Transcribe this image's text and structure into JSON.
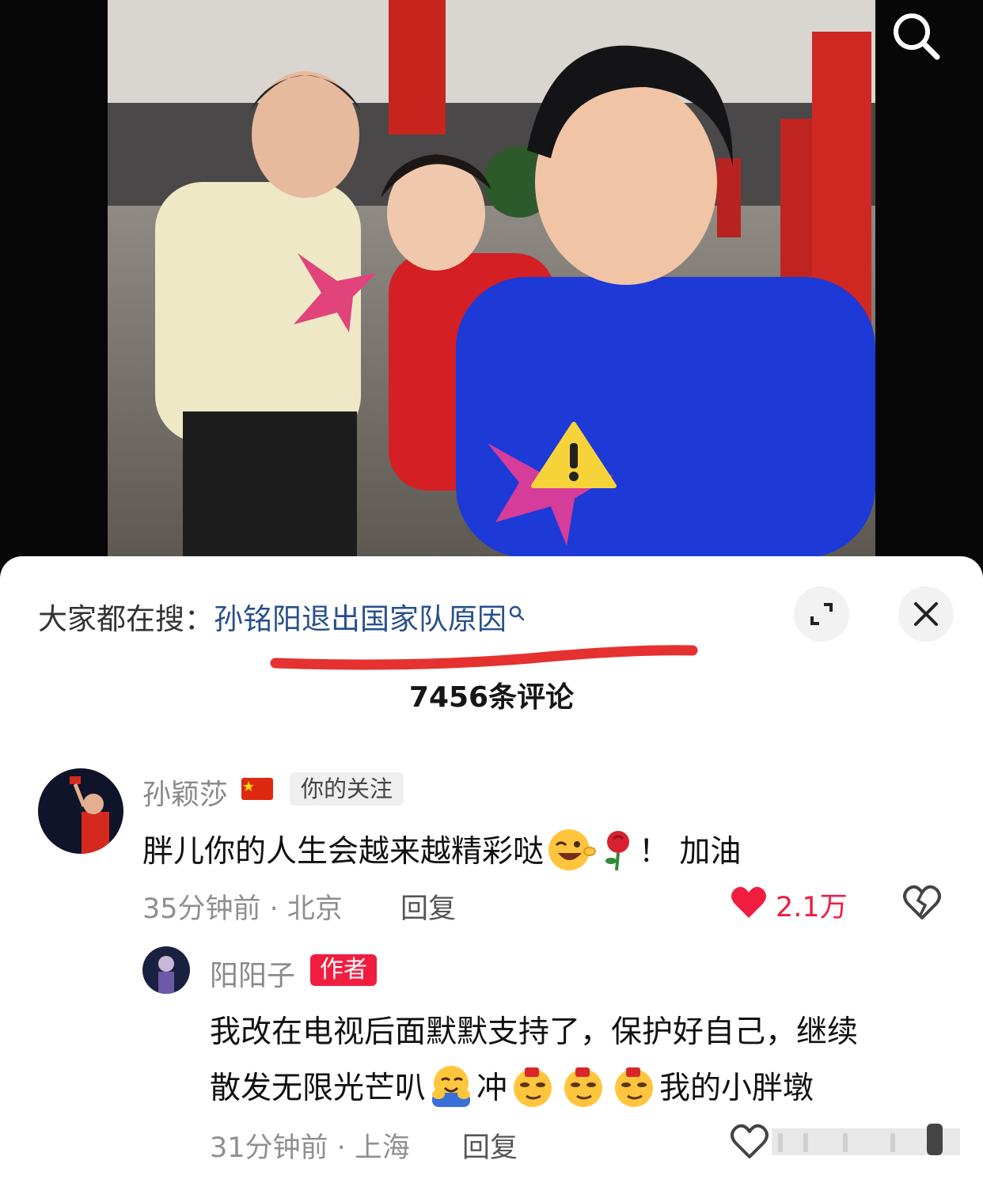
{
  "hot_search": {
    "prefix": "大家都在搜：",
    "query": "孙铭阳退出国家队原因"
  },
  "comment_count": "7456条评论",
  "comments": [
    {
      "user": "孙颖莎",
      "badge": "你的关注",
      "text_main": "胖儿你的人生会越来越精彩哒",
      "text_tail": "！ 加油",
      "time_loc": "35分钟前 · 北京",
      "reply_label": "回复",
      "likes": "2.1万"
    },
    {
      "user": "阳阳子",
      "badge": "作者",
      "line1": "我改在电视后面默默支持了，保护好自己，继续",
      "line2_a": "散发无限光芒叭",
      "line2_b": "冲",
      "line2_c": "我的小胖墩",
      "time_loc": "31分钟前 · 上海",
      "reply_label": "回复"
    }
  ],
  "colors": {
    "accent_red": "#f01d41",
    "link_blue": "#28508c"
  },
  "icons": [
    "search-icon",
    "expand-icon",
    "close-icon",
    "heart-filled-icon",
    "dislike-heart-icon",
    "heart-outline-icon",
    "warning-icon"
  ]
}
